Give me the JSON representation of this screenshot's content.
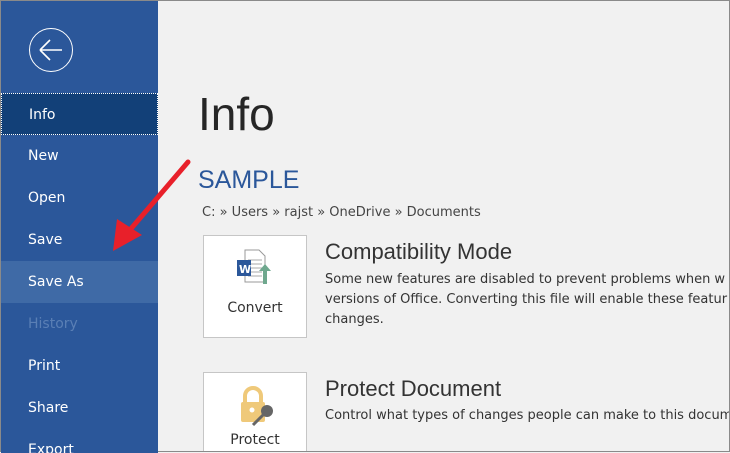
{
  "sidebar": {
    "items": [
      {
        "label": "Info",
        "state": "active"
      },
      {
        "label": "New"
      },
      {
        "label": "Open"
      },
      {
        "label": "Save"
      },
      {
        "label": "Save As",
        "state": "hover"
      },
      {
        "label": "History",
        "state": "disabled"
      },
      {
        "label": "Print"
      },
      {
        "label": "Share"
      },
      {
        "label": "Export"
      }
    ]
  },
  "main": {
    "title": "Info",
    "doc_name": "SAMPLE",
    "path": "C: » Users » rajst » OneDrive » Documents",
    "compat": {
      "button": "Convert",
      "heading": "Compatibility Mode",
      "lines": [
        "Some new features are disabled to prevent problems when w",
        "versions of Office. Converting this file will enable these featur",
        "changes."
      ]
    },
    "protect": {
      "button": "Protect Document",
      "heading": "Protect Document",
      "text": "Control what types of changes people can make to this docum"
    }
  },
  "colors": {
    "sidebar": "#2b579a",
    "active": "#124078",
    "annotation_arrow": "#e8202a"
  }
}
